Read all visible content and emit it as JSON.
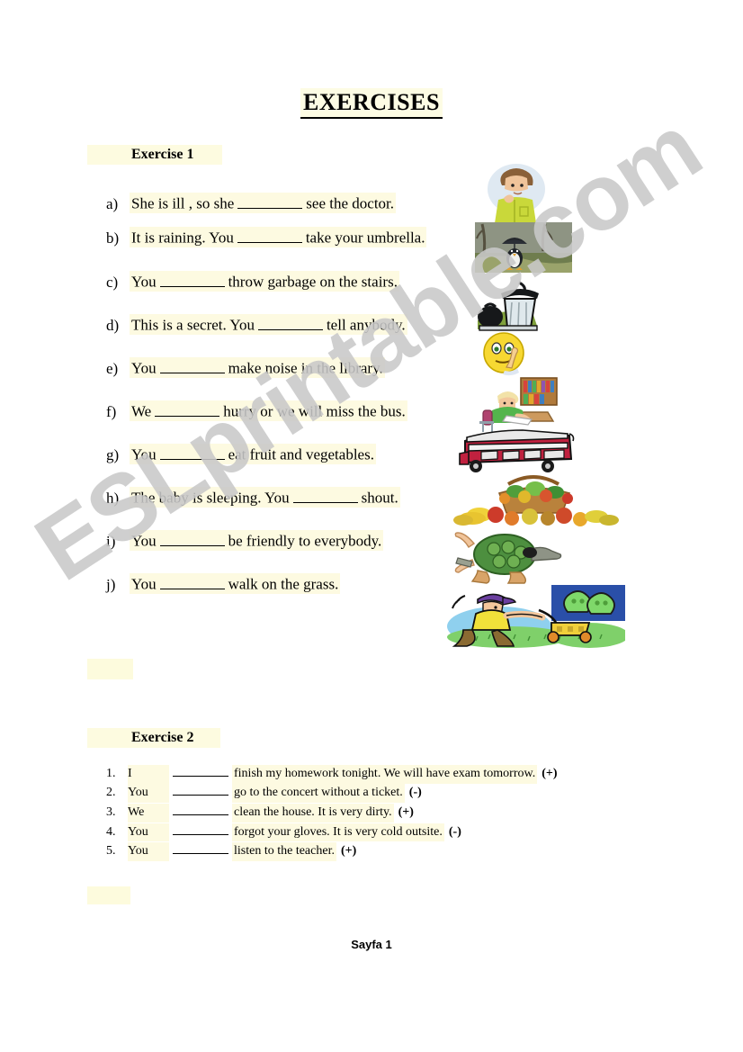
{
  "document": {
    "title": "EXERCISES",
    "footer": "Sayfa 1",
    "watermark": "ESLprintable.com",
    "highlight_color": "#fdfae1",
    "text_color": "#000000"
  },
  "exercise1": {
    "heading": "Exercise  1",
    "items": [
      {
        "label": "a)",
        "before": "She is ill , so she",
        "after": "see the doctor.",
        "answer_blank": "_________"
      },
      {
        "label": "b)",
        "before": "It is raining. You",
        "after": "take your umbrella.",
        "answer_blank": "_________"
      },
      {
        "label": "c)",
        "before": "You",
        "after": "throw garbage on the stairs.",
        "answer_blank": "_________"
      },
      {
        "label": "d)",
        "before": "This is a secret. You",
        "after": "tell anybody.",
        "answer_blank": "_________"
      },
      {
        "label": "e)",
        "before": "You",
        "after": "make noise in the library.",
        "answer_blank": "_________"
      },
      {
        "label": "f)",
        "before": "We",
        "after": "hurry or we will miss the bus.",
        "answer_blank": "_________"
      },
      {
        "label": "g)",
        "before": "You",
        "after": "eat fruit and vegetables.",
        "answer_blank": "_________"
      },
      {
        "label": "h)",
        "before": "The baby is sleeping. You",
        "after": "shout.",
        "answer_blank": "_________"
      },
      {
        "label": "i)",
        "before": "You",
        "after": "be friendly to everybody.",
        "answer_blank": "_________"
      },
      {
        "label": "j)",
        "before": "You",
        "after": "walk on the grass.",
        "answer_blank": "_________"
      }
    ]
  },
  "exercise2": {
    "heading": "Exercise 2",
    "items": [
      {
        "num": "1.",
        "subject": "I",
        "rest": "finish my homework tonight. We will have exam tomorrow.",
        "sign": "(+)"
      },
      {
        "num": "2.",
        "subject": "You",
        "rest": "go to the concert without a ticket.",
        "sign": "(-)"
      },
      {
        "num": "3.",
        "subject": "We",
        "rest": "clean the house. It is very dirty.",
        "sign": "(+)"
      },
      {
        "num": "4.",
        "subject": "You",
        "rest": "forgot your gloves. It is very cold outsite.",
        "sign": "(-)"
      },
      {
        "num": "5.",
        "subject": "You",
        "rest": "listen to the teacher.",
        "sign": "(+)"
      }
    ]
  },
  "clipart": [
    {
      "name": "sick-man-coughing-image",
      "alt": "Man coughing into his hand"
    },
    {
      "name": "penguin-with-umbrella-image",
      "alt": "Penguin holding umbrella in the rain"
    },
    {
      "name": "garbage-can-image",
      "alt": "Trash can with garbage bag"
    },
    {
      "name": "shh-smiley-image",
      "alt": "Yellow smiley with finger to lips saying shh"
    },
    {
      "name": "student-in-library-image",
      "alt": "Student reading at a library desk"
    },
    {
      "name": "red-double-decker-bus-image",
      "alt": "Red double decker bus"
    },
    {
      "name": "fruit-and-vegetables-basket-image",
      "alt": "Basket of fruit and vegetables"
    },
    {
      "name": "soldier-turtle-image",
      "alt": "Turtle soldier in green uniform"
    },
    {
      "name": "man-mowing-lawn-image",
      "alt": "Man pushing a lawn mower on grass"
    }
  ]
}
